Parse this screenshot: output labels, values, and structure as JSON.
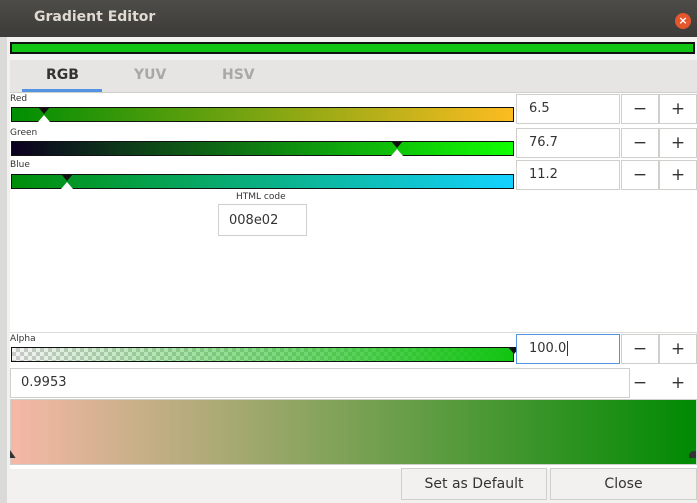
{
  "window": {
    "title": "Gradient Editor",
    "close_icon": "close-icon"
  },
  "tabs": [
    {
      "label": "RGB",
      "active": true
    },
    {
      "label": "YUV",
      "active": false
    },
    {
      "label": "HSV",
      "active": false
    }
  ],
  "channels": {
    "red": {
      "label": "Red",
      "value": "6.5",
      "fraction": 0.065
    },
    "green": {
      "label": "Green",
      "value": "76.7",
      "fraction": 0.767
    },
    "blue": {
      "label": "Blue",
      "value": "11.2",
      "fraction": 0.112
    }
  },
  "html_code": {
    "label": "HTML code",
    "value": "008e02"
  },
  "alpha": {
    "label": "Alpha",
    "value": "100.0",
    "fraction": 1.0
  },
  "position": {
    "value": "0.9953"
  },
  "buttons": {
    "minus": "−",
    "plus": "+",
    "set_default": "Set as Default",
    "close": "Close"
  },
  "colors": {
    "selected": "#008e02",
    "gradient_start": "#f6b8a7",
    "gradient_end": "#008a02",
    "accent": "#5294e2"
  }
}
